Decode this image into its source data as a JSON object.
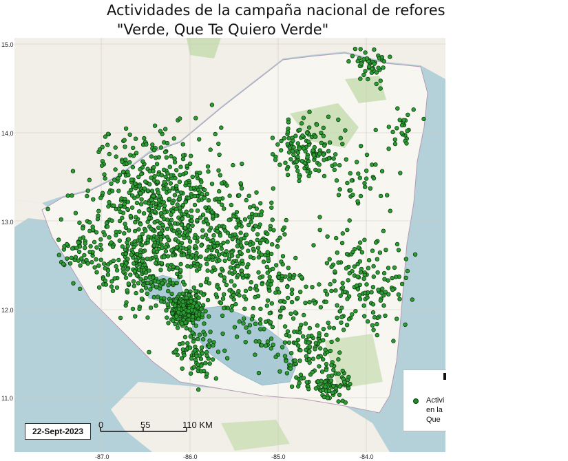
{
  "title_line1": "Actividades de la campaña nacional de reforestación",
  "title_line2": "\"Verde, Que Te Quiero Verde\"",
  "date_label": "22-Sept-2023",
  "scale_bar": {
    "label_0": "0",
    "label_mid": "55",
    "label_end": "110 KM"
  },
  "legend": {
    "entry_text": "Activi\nen la\nQue "
  },
  "lat_labels": [
    "15.0",
    "14.0",
    "13.0",
    "12.0",
    "11.0"
  ],
  "lon_labels": [
    "-87.0",
    "-86.0",
    "-85.0",
    "-84.0"
  ],
  "colors": {
    "sea": "#b4d0d9",
    "land": "#f2efe8",
    "nicaragua_land": "#f7f6f1",
    "forest": "#bcd9a4",
    "lake": "#aacbd6",
    "point_fill": "#2c9d33",
    "point_stroke": "#0d3b10"
  },
  "point_clusters": [
    {
      "lon": -86.35,
      "lat": 13.2,
      "spread": 0.55,
      "count": 520
    },
    {
      "lon": -86.05,
      "lat": 12.0,
      "spread": 0.12,
      "count": 260
    },
    {
      "lon": -86.5,
      "lat": 12.45,
      "spread": 0.35,
      "count": 220
    },
    {
      "lon": -85.5,
      "lat": 12.7,
      "spread": 0.45,
      "count": 260
    },
    {
      "lon": -84.7,
      "lat": 13.8,
      "spread": 0.25,
      "count": 130
    },
    {
      "lon": -84.1,
      "lat": 12.3,
      "spread": 0.4,
      "count": 160
    },
    {
      "lon": -84.7,
      "lat": 11.5,
      "spread": 0.3,
      "count": 110
    },
    {
      "lon": -84.4,
      "lat": 11.15,
      "spread": 0.15,
      "count": 70
    },
    {
      "lon": -85.2,
      "lat": 12.1,
      "spread": 0.45,
      "count": 140
    },
    {
      "lon": -83.95,
      "lat": 14.75,
      "spread": 0.15,
      "count": 45
    },
    {
      "lon": -85.9,
      "lat": 11.5,
      "spread": 0.2,
      "count": 70
    },
    {
      "lon": -87.2,
      "lat": 12.7,
      "spread": 0.2,
      "count": 60
    },
    {
      "lon": -84.1,
      "lat": 13.5,
      "spread": 0.3,
      "count": 40
    },
    {
      "lon": -83.6,
      "lat": 14.0,
      "spread": 0.15,
      "count": 25
    }
  ]
}
